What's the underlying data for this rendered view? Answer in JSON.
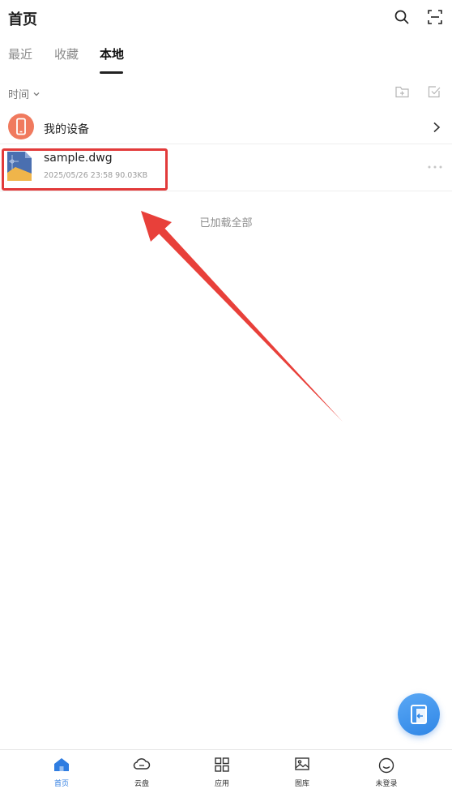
{
  "header": {
    "title": "首页",
    "search_icon": "search-icon",
    "scan_icon": "scan-icon"
  },
  "tabs": [
    {
      "label": "最近",
      "active": false
    },
    {
      "label": "收藏",
      "active": false
    },
    {
      "label": "本地",
      "active": true
    }
  ],
  "toolbar": {
    "sort_label": "时间",
    "new_folder_icon": "add-folder-icon",
    "select_icon": "checkbox-icon"
  },
  "device_row": {
    "label": "我的设备",
    "icon": "phone-icon",
    "icon_color": "#f07a5e"
  },
  "files": [
    {
      "name": "sample.dwg",
      "meta": "2025/05/26 23:58  90.03KB",
      "icon": "dwg-file-icon"
    }
  ],
  "list_footer": "已加载全部",
  "annotation": {
    "highlight_color": "#e23a3a"
  },
  "bottom_nav": [
    {
      "label": "首页",
      "icon": "home-icon",
      "active": true
    },
    {
      "label": "云盘",
      "icon": "cloud-icon",
      "active": false
    },
    {
      "label": "应用",
      "icon": "apps-grid-icon",
      "active": false
    },
    {
      "label": "图库",
      "icon": "image-icon",
      "active": false
    },
    {
      "label": "未登录",
      "icon": "smiley-icon",
      "active": false
    }
  ],
  "accent_color": "#2f7de1"
}
